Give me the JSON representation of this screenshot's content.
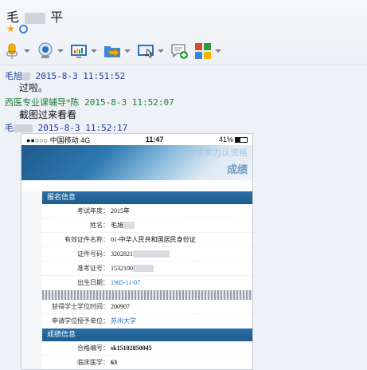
{
  "window": {
    "title": "毛",
    "title_suffix": "平"
  },
  "toolbar": {
    "icons": [
      "microphone-icon",
      "webcam-icon",
      "screen-share-icon",
      "file-send-icon",
      "remote-assist-icon",
      "sms-icon",
      "apps-icon"
    ]
  },
  "messages": [
    {
      "sender": "毛旭",
      "time": "2015-8-3 11:51:52",
      "text": "过啦。",
      "color": "#1a3aa8"
    },
    {
      "sender": "西医专业课辅导*陈",
      "time": "2015-8-3 11:52:07",
      "text": "截图过来看看",
      "color": "#1e7d3a"
    },
    {
      "sender": "毛",
      "time": "2015-8-3 11:52:17",
      "text": "",
      "color": "#1a3aa8"
    }
  ],
  "screenshot": {
    "status": {
      "carrier": "●●○○○ 中国移动",
      "network": "4G",
      "time": "11:47",
      "battery": "41%"
    },
    "banner": {
      "line1": "高等学力认资格",
      "line2": "成绩"
    },
    "section1": "报名信息",
    "fields": [
      {
        "label": "考试年度：",
        "value": "2015年"
      },
      {
        "label": "姓名：",
        "value": "毛旭"
      },
      {
        "label": "有效证件名称：",
        "value": "01-中华人民共和国居民身份证"
      },
      {
        "label": "证件号码：",
        "value": "3202821"
      },
      {
        "label": "准考证号：",
        "value": "1532100"
      },
      {
        "label": "出生日期：",
        "value": "1985-11-07"
      }
    ],
    "fields2": [
      {
        "label": "获得学士学位时间：",
        "value": "200907"
      },
      {
        "label": "申请学位授予单位：",
        "value": "苏州大学"
      }
    ],
    "section2": "成绩信息",
    "scores": [
      {
        "label": "合格编号：",
        "value": "sk15102850045"
      },
      {
        "label": "临床医学：",
        "value": "63"
      }
    ]
  }
}
